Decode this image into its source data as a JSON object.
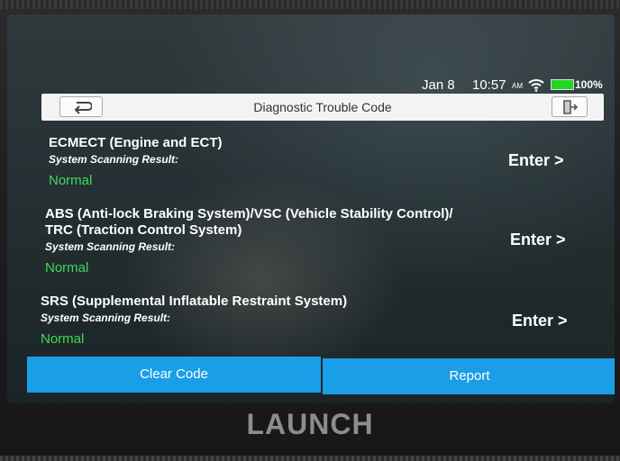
{
  "status_bar": {
    "date": "Jan 8",
    "time": "10:57",
    "ampm": "AM",
    "battery": "100%"
  },
  "title_bar": {
    "title": "Diagnostic Trouble Code"
  },
  "systems": [
    {
      "name": "ECMECT (Engine and ECT)",
      "label": "System Scanning Result:",
      "status": "Normal",
      "enter": "Enter >"
    },
    {
      "name_line1": "ABS (Anti-lock Braking System)/VSC (Vehicle Stability Control)/",
      "name_line2": "TRC (Traction Control System)",
      "label": "System Scanning Result:",
      "status": "Normal",
      "enter": "Enter >"
    },
    {
      "name": "SRS (Supplemental Inflatable Restraint System)",
      "label": "System Scanning Result:",
      "status": "Normal",
      "enter": "Enter >"
    }
  ],
  "buttons": {
    "clear_code": "Clear Code",
    "report": "Report"
  },
  "brand": "LAUNCH",
  "colors": {
    "accent": "#1a9ee8",
    "normal_status": "#3ddc5b",
    "battery": "#1fd81f"
  }
}
